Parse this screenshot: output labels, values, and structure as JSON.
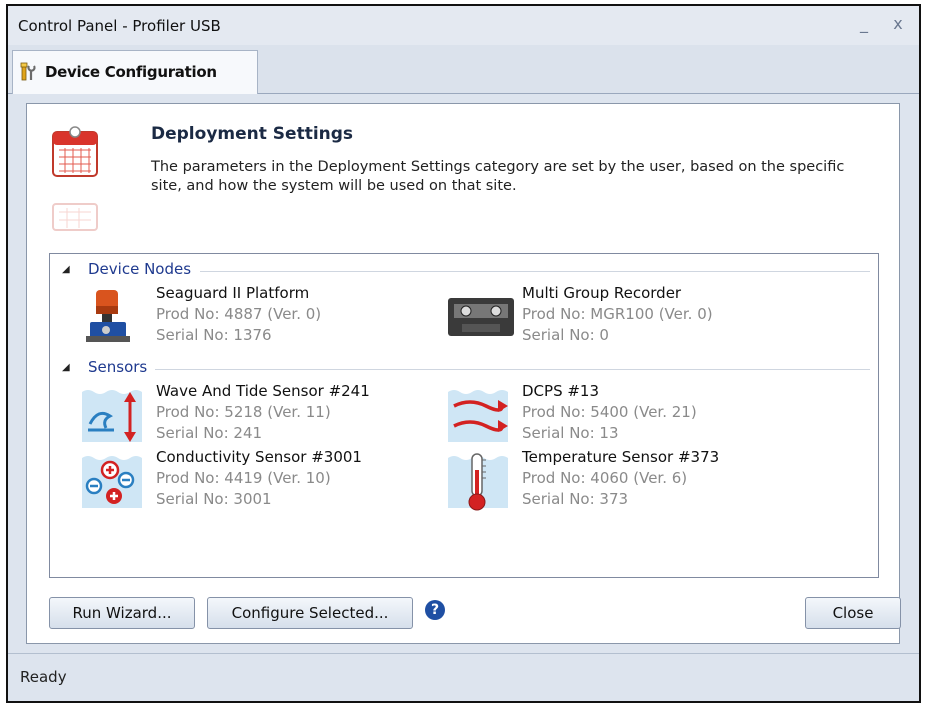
{
  "window": {
    "title": "Control Panel - Profiler USB",
    "minimize": "_",
    "close": "x"
  },
  "tab": {
    "label": "Device Configuration",
    "icon": "tools-icon"
  },
  "header": {
    "title": "Deployment Settings",
    "description": "The parameters in the Deployment Settings category are set by the user, based on the specific site, and how the system will be used on that site.",
    "icon": "calendar-icon"
  },
  "groups": {
    "device_nodes": {
      "label": "Device Nodes",
      "items": [
        {
          "name": "Seaguard II Platform",
          "prod": "Prod No: 4887 (Ver. 0)",
          "serial": "Serial No: 1376",
          "icon": "platform-icon"
        },
        {
          "name": "Multi Group Recorder",
          "prod": "Prod No: MGR100 (Ver. 0)",
          "serial": "Serial No: 0",
          "icon": "recorder-icon"
        }
      ]
    },
    "sensors": {
      "label": "Sensors",
      "items": [
        {
          "name": "Wave And Tide Sensor #241",
          "prod": "Prod No: 5218 (Ver. 11)",
          "serial": "Serial No: 241",
          "icon": "wave-tide-icon"
        },
        {
          "name": "DCPS #13",
          "prod": "Prod No: 5400 (Ver. 21)",
          "serial": "Serial No: 13",
          "icon": "current-profiler-icon"
        },
        {
          "name": "Conductivity Sensor #3001",
          "prod": "Prod No: 4419 (Ver. 10)",
          "serial": "Serial No: 3001",
          "icon": "conductivity-icon"
        },
        {
          "name": "Temperature Sensor #373",
          "prod": "Prod No: 4060 (Ver. 6)",
          "serial": "Serial No: 373",
          "icon": "thermometer-icon"
        }
      ]
    }
  },
  "buttons": {
    "run_wizard": "Run Wizard...",
    "configure_selected": "Configure Selected...",
    "help": "?",
    "close": "Close"
  },
  "status": {
    "text": "Ready"
  }
}
